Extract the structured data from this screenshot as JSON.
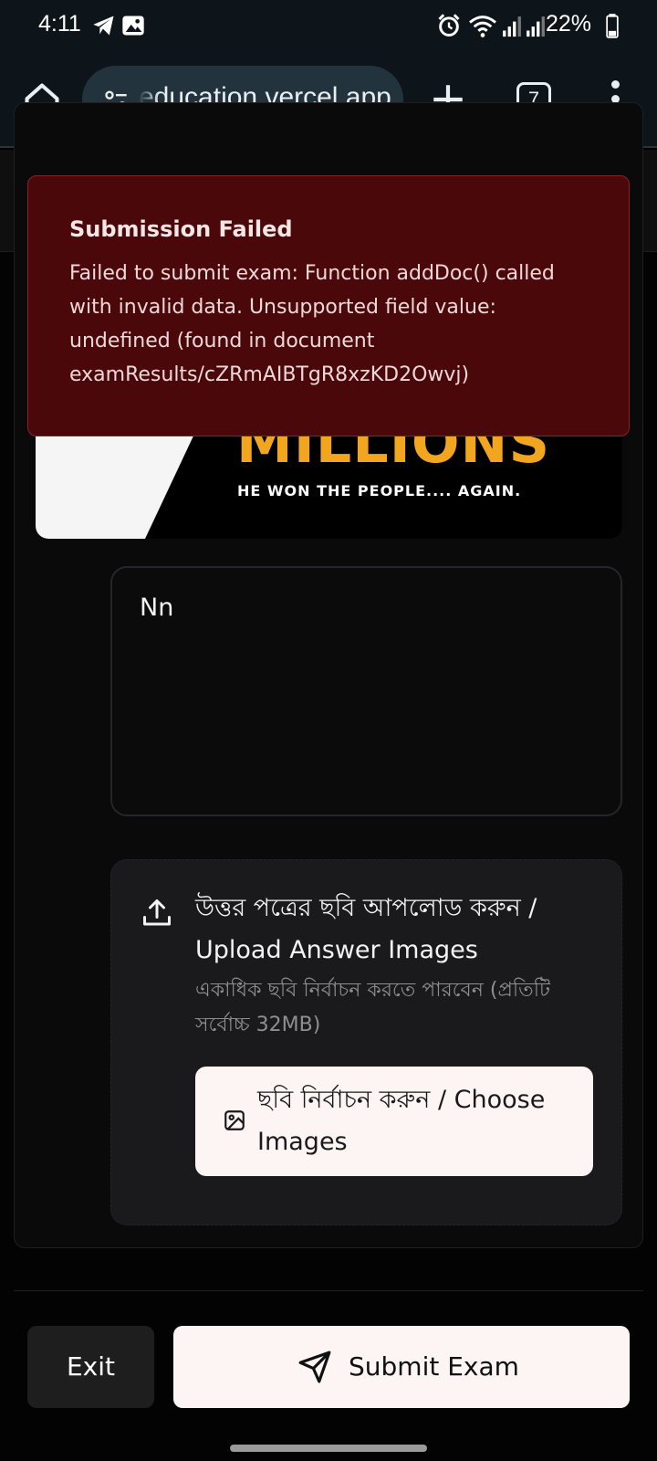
{
  "status_bar": {
    "time": "4:11",
    "battery_percent": "22%",
    "icons": [
      "telegram-icon",
      "gallery-icon",
      "alarm-icon",
      "wifi-icon",
      "signal-icon",
      "signal-icon",
      "battery-icon"
    ]
  },
  "browser": {
    "url": "education.vercel.app",
    "tab_count": "7"
  },
  "banner": {
    "title": "MILLIONS",
    "subtitle": "HE WON THE PEOPLE.... AGAIN."
  },
  "answer": {
    "value": "Nn"
  },
  "upload": {
    "title": "উত্তর পত্রের ছবি আপলোড করুন / Upload Answer Images",
    "hint": "একাধিক ছবি নির্বাচন করতে পারবেন (প্রতিটি সর্বোচ্চ 32MB)",
    "choose_label": "ছবি নির্বাচন করুন / Choose Images"
  },
  "toast": {
    "title": "Submission Failed",
    "message": "Failed to submit exam: Function addDoc() called with invalid data. Unsupported field value: undefined (found in document examResults/cZRmAIBTgR8xzKD2Owvj)"
  },
  "actions": {
    "exit_label": "Exit",
    "submit_label": "Submit Exam"
  },
  "colors": {
    "toast_bg": "#4a080a",
    "banner_accent": "#f2a51f",
    "primary_button": "#fdf4f4"
  }
}
